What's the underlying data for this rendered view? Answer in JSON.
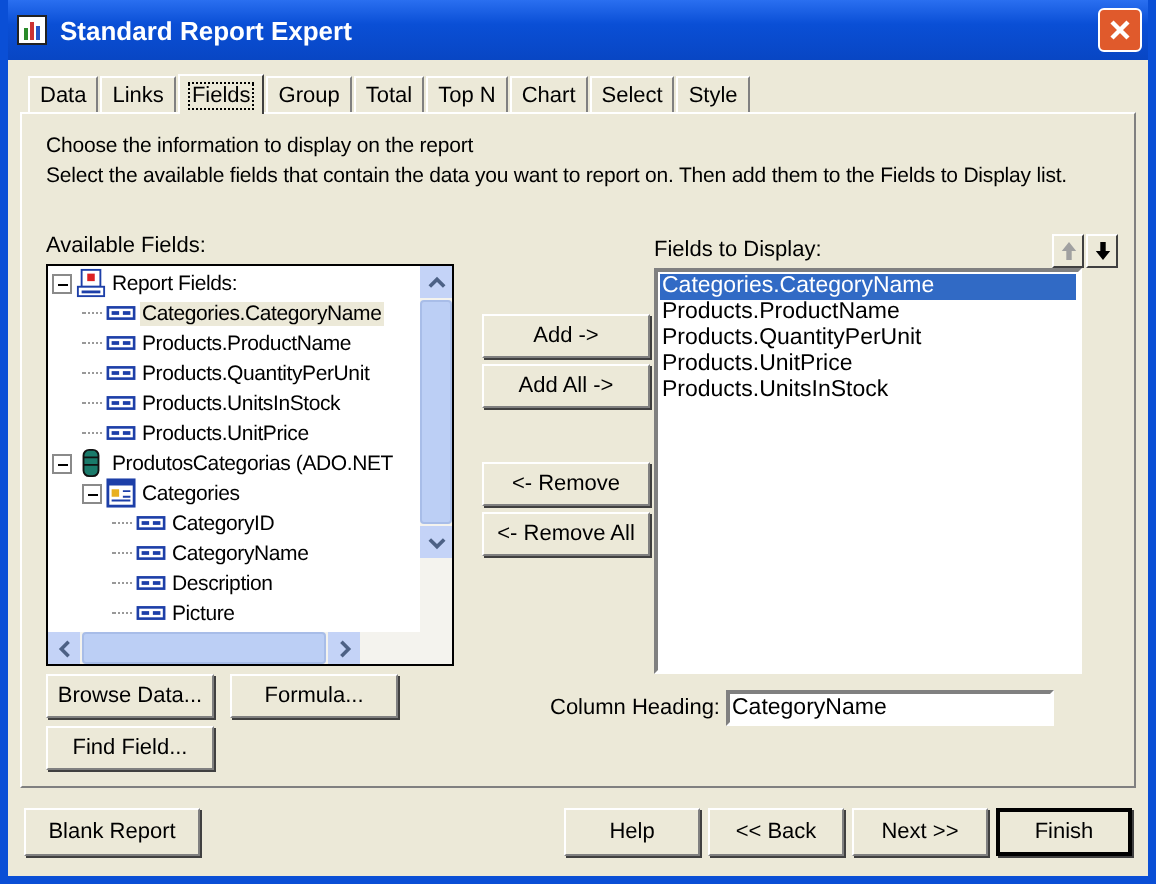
{
  "window": {
    "title": "Standard Report Expert"
  },
  "tabs": [
    {
      "label": "Data",
      "selected": false
    },
    {
      "label": "Links",
      "selected": false
    },
    {
      "label": "Fields",
      "selected": true
    },
    {
      "label": "Group",
      "selected": false
    },
    {
      "label": "Total",
      "selected": false
    },
    {
      "label": "Top N",
      "selected": false
    },
    {
      "label": "Chart",
      "selected": false
    },
    {
      "label": "Select",
      "selected": false
    },
    {
      "label": "Style",
      "selected": false
    }
  ],
  "instructions": [
    "Choose the information to display on the report",
    "Select the available fields that contain the data you want to report on.  Then add them to the Fields to Display list."
  ],
  "available_fields": {
    "label": "Available Fields:",
    "tree": [
      {
        "kind": "report",
        "label": "Report Fields:",
        "expanded": true,
        "selected": false,
        "children": [
          {
            "kind": "field",
            "label": "Categories.CategoryName",
            "selected": true
          },
          {
            "kind": "field",
            "label": "Products.ProductName",
            "selected": false
          },
          {
            "kind": "field",
            "label": "Products.QuantityPerUnit",
            "selected": false
          },
          {
            "kind": "field",
            "label": "Products.UnitsInStock",
            "selected": false
          },
          {
            "kind": "field",
            "label": "Products.UnitPrice",
            "selected": false
          }
        ]
      },
      {
        "kind": "database",
        "label": "ProdutosCategorias (ADO.NET",
        "expanded": true,
        "selected": false,
        "children": [
          {
            "kind": "table",
            "label": "Categories",
            "expanded": true,
            "selected": false,
            "children": [
              {
                "kind": "field",
                "label": "CategoryID",
                "selected": false
              },
              {
                "kind": "field",
                "label": "CategoryName",
                "selected": false
              },
              {
                "kind": "field",
                "label": "Description",
                "selected": false
              },
              {
                "kind": "field",
                "label": "Picture",
                "selected": false
              }
            ]
          }
        ]
      }
    ]
  },
  "transfer_buttons": [
    "Add ->",
    "Add All ->",
    "<- Remove",
    "<- Remove All"
  ],
  "fields_to_display": {
    "label": "Fields to Display:",
    "move_up": {
      "disabled": true
    },
    "move_down": {
      "disabled": false
    },
    "items": [
      {
        "label": "Categories.CategoryName",
        "selected": true
      },
      {
        "label": "Products.ProductName",
        "selected": false
      },
      {
        "label": "Products.QuantityPerUnit",
        "selected": false
      },
      {
        "label": "Products.UnitPrice",
        "selected": false
      },
      {
        "label": "Products.UnitsInStock",
        "selected": false
      }
    ]
  },
  "field_buttons": [
    "Browse Data...",
    "Formula...",
    "Find Field..."
  ],
  "column_heading": {
    "label": "Column Heading:",
    "value": "CategoryName"
  },
  "footer_buttons": [
    {
      "label": "Blank Report",
      "default": false
    },
    {
      "label": "Help",
      "default": false
    },
    {
      "label": "<< Back",
      "default": false
    },
    {
      "label": "Next >>",
      "default": false
    },
    {
      "label": "Finish",
      "default": true
    }
  ]
}
